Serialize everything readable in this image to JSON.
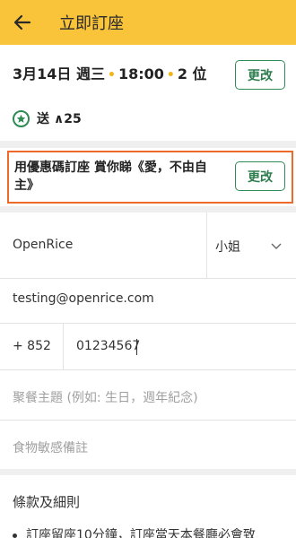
{
  "appbar": {
    "title": "立即訂座"
  },
  "booking": {
    "date": "3月14日 週三",
    "time": "18:00",
    "seats": "2 位",
    "edit_label": "更改",
    "reward_text": "送 ∧25"
  },
  "promo": {
    "text": "用優惠碼訂座 賞你睇《愛，不由自主》",
    "edit_label": "更改"
  },
  "form": {
    "name_value": "OpenRice",
    "title_value": "小姐",
    "email_value": "testing@openrice.com",
    "country_code": "+ 852",
    "phone_value": "01234567",
    "theme_placeholder": "聚餐主題 (例如: 生日，週年紀念)",
    "allergy_placeholder": "食物敏感備註"
  },
  "terms": {
    "title": "條款及細則",
    "first_item": "訂座留座10分鐘，訂座當天本餐廳必會致"
  },
  "colors": {
    "appbar": "#f9c33a",
    "accent_green": "#2e8b53",
    "highlight_orange": "#ee6a2a",
    "dot_yellow": "#f2b418"
  }
}
